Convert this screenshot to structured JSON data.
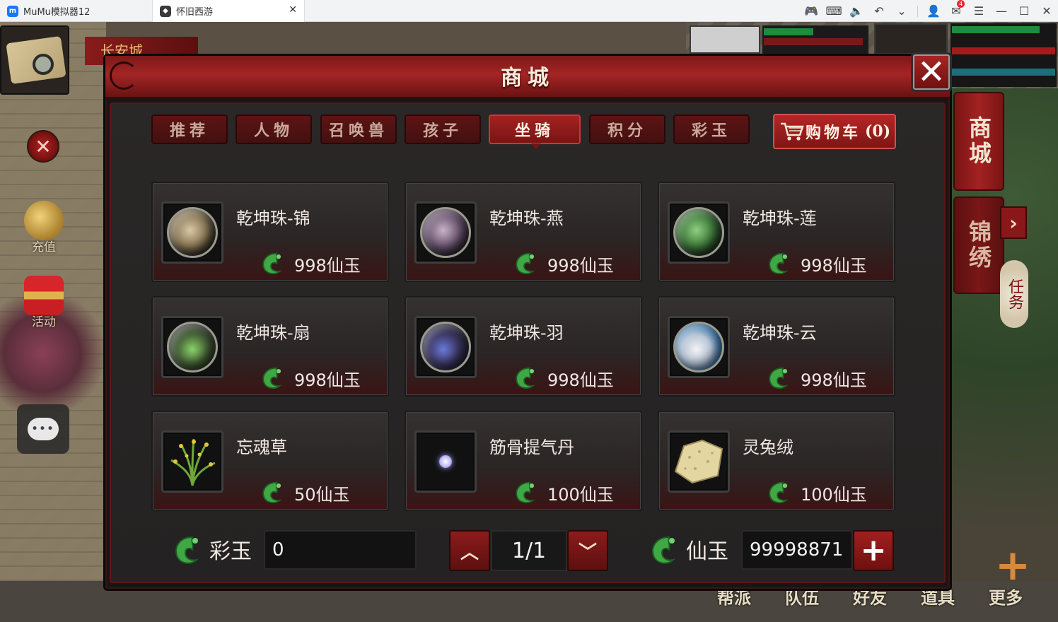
{
  "window": {
    "app_tab": "MuMu模拟器12",
    "game_tab": "怀旧西游",
    "mail_badge": "4"
  },
  "scene": {
    "city_name": "长安城",
    "recharge_label": "充值",
    "event_label": "活动",
    "side_tab_shop": "商城",
    "side_tab_brocade": "锦绣",
    "task_label": "任务",
    "bottom_menu": [
      "帮派",
      "队伍",
      "好友",
      "道具",
      "更多"
    ]
  },
  "shop": {
    "title": "商城",
    "tabs": [
      {
        "label": "推荐"
      },
      {
        "label": "人物"
      },
      {
        "label": "召唤兽"
      },
      {
        "label": "孩子"
      },
      {
        "label": "坐骑",
        "active": true
      },
      {
        "label": "积分"
      },
      {
        "label": "彩玉"
      }
    ],
    "cart_label": "购物车",
    "cart_count": "(0)",
    "items": [
      {
        "name": "乾坤珠-锦",
        "price": "998仙玉",
        "icon": "carpet-orb"
      },
      {
        "name": "乾坤珠-燕",
        "price": "998仙玉",
        "icon": "swallow-orb"
      },
      {
        "name": "乾坤珠-莲",
        "price": "998仙玉",
        "icon": "lotus-orb"
      },
      {
        "name": "乾坤珠-扇",
        "price": "998仙玉",
        "icon": "fan-orb"
      },
      {
        "name": "乾坤珠-羽",
        "price": "998仙玉",
        "icon": "feather-orb"
      },
      {
        "name": "乾坤珠-云",
        "price": "998仙玉",
        "icon": "cloud-orb"
      },
      {
        "name": "忘魂草",
        "price": "50仙玉",
        "icon": "herb"
      },
      {
        "name": "筋骨提气丹",
        "price": "100仙玉",
        "icon": "pill"
      },
      {
        "name": "灵兔绒",
        "price": "100仙玉",
        "icon": "fur-cloth"
      }
    ],
    "footer": {
      "caiyu_label": "彩玉",
      "caiyu_value": "0",
      "page": "1/1",
      "xianyu_label": "仙玉",
      "xianyu_value": "99998871"
    }
  },
  "colors": {
    "accent_red": "#a32525",
    "jade_green": "#3fa845",
    "panel": "#2a2727"
  }
}
